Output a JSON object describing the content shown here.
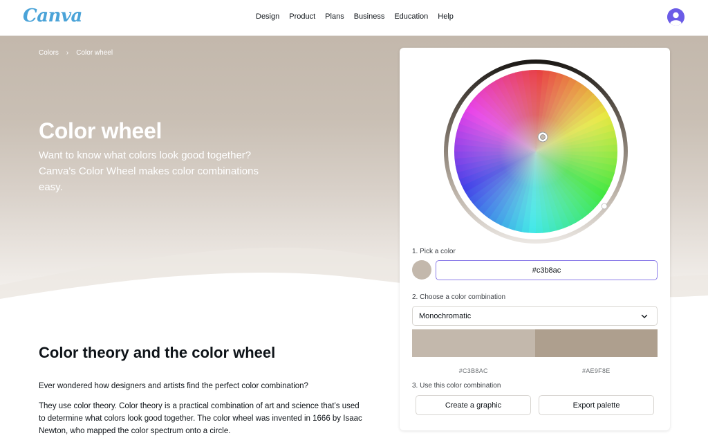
{
  "brand": {
    "logo_text": "Canva",
    "logo_accent_text": "",
    "accent": "#7d2ae8"
  },
  "nav": {
    "items": [
      "Design",
      "Product",
      "Plans",
      "Business",
      "Education",
      "Help"
    ]
  },
  "user": {
    "avatar_icon": "user-avatar-icon"
  },
  "breadcrumb": {
    "items": [
      "Colors",
      "Color wheel"
    ],
    "separator": "›"
  },
  "hero": {
    "title": "Color wheel",
    "subtitle": "Want to know what colors look good together? Canva's Color Wheel makes color combinations easy.",
    "background": "#c3b8ac"
  },
  "content": {
    "section_title": "Color theory and the color wheel",
    "para1": "Ever wondered how designers and artists find the perfect color combination?",
    "para2": "They use color theory. Color theory is a practical combination of art and science that’s used to determine what colors look good together. The color wheel was invented in 1666 by Isaac Newton, who mapped the color spectrum onto a circle."
  },
  "tool": {
    "step1_label": "1. Pick a color",
    "selected_color": "#c3b8ac",
    "hex_value": "#c3b8ac",
    "step2_label": "2. Choose a color combination",
    "combination": "Monochromatic",
    "palette": [
      {
        "hex": "#C3B8AC",
        "color": "#c3b8ac"
      },
      {
        "hex": "#AE9F8E",
        "color": "#ae9f8e"
      }
    ],
    "step3_label": "3. Use this color combination",
    "create_button": "Create a graphic",
    "export_button": "Export palette"
  }
}
